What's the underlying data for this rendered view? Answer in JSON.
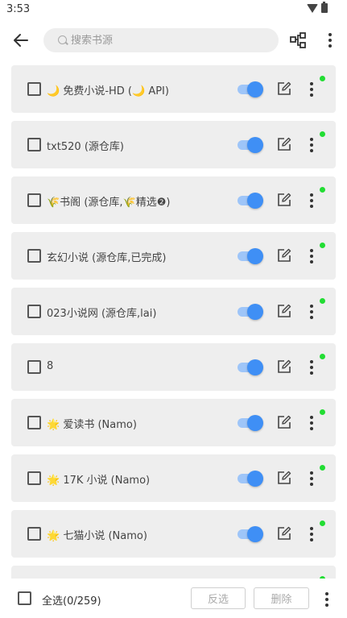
{
  "status": {
    "time": "3:53"
  },
  "toolbar": {
    "search_placeholder": "搜索书源"
  },
  "sources": [
    {
      "name": "🌙 免费小说-HD (🌙 API)",
      "enabled": true
    },
    {
      "name": "txt520 (源仓库)",
      "enabled": true
    },
    {
      "name": "🌾书阁 (源仓库,🌾精选❷)",
      "enabled": true
    },
    {
      "name": "玄幻小说 (源仓库,已完成)",
      "enabled": true
    },
    {
      "name": "023小说网 (源仓库,lai)",
      "enabled": true
    },
    {
      "name": "8",
      "enabled": true
    },
    {
      "name": "🌟 爱读书 (Namo)",
      "enabled": true
    },
    {
      "name": "🌟 17K 小说 (Namo)",
      "enabled": true
    },
    {
      "name": "🌟 七猫小说 (Namo)",
      "enabled": true
    },
    {
      "name": "",
      "enabled": true
    }
  ],
  "bottom": {
    "select_all_label": "全选(0/259)",
    "invert_label": "反选",
    "delete_label": "删除"
  },
  "colors": {
    "accent": "#3f8ff5",
    "status_dot": "#22dd33",
    "card_bg": "#eeeeee"
  }
}
